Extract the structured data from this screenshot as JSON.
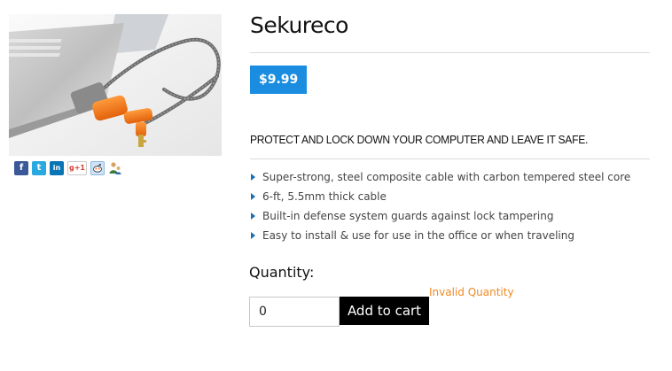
{
  "product": {
    "title": "Sekureco",
    "price": "$9.99",
    "tagline": "PROTECT AND LOCK DOWN YOUR COMPUTER AND LEAVE IT SAFE.",
    "features": [
      "Super-strong, steel composite cable with carbon tempered steel core",
      "6-ft, 5.5mm thick cable",
      "Built-in defense system guards against lock tampering",
      "Easy to install & use for use in the office or when traveling"
    ]
  },
  "social": {
    "facebook_glyph": "f",
    "twitter_glyph": "t",
    "linkedin_glyph": "in",
    "googleplus_glyph": "g+1"
  },
  "purchase": {
    "quantity_label": "Quantity:",
    "quantity_value": "0",
    "add_to_cart_label": "Add to cart",
    "error_message": "Invalid Quantity"
  },
  "colors": {
    "price_badge": "#1a8de0",
    "error": "#f08a24",
    "button": "#000000"
  }
}
